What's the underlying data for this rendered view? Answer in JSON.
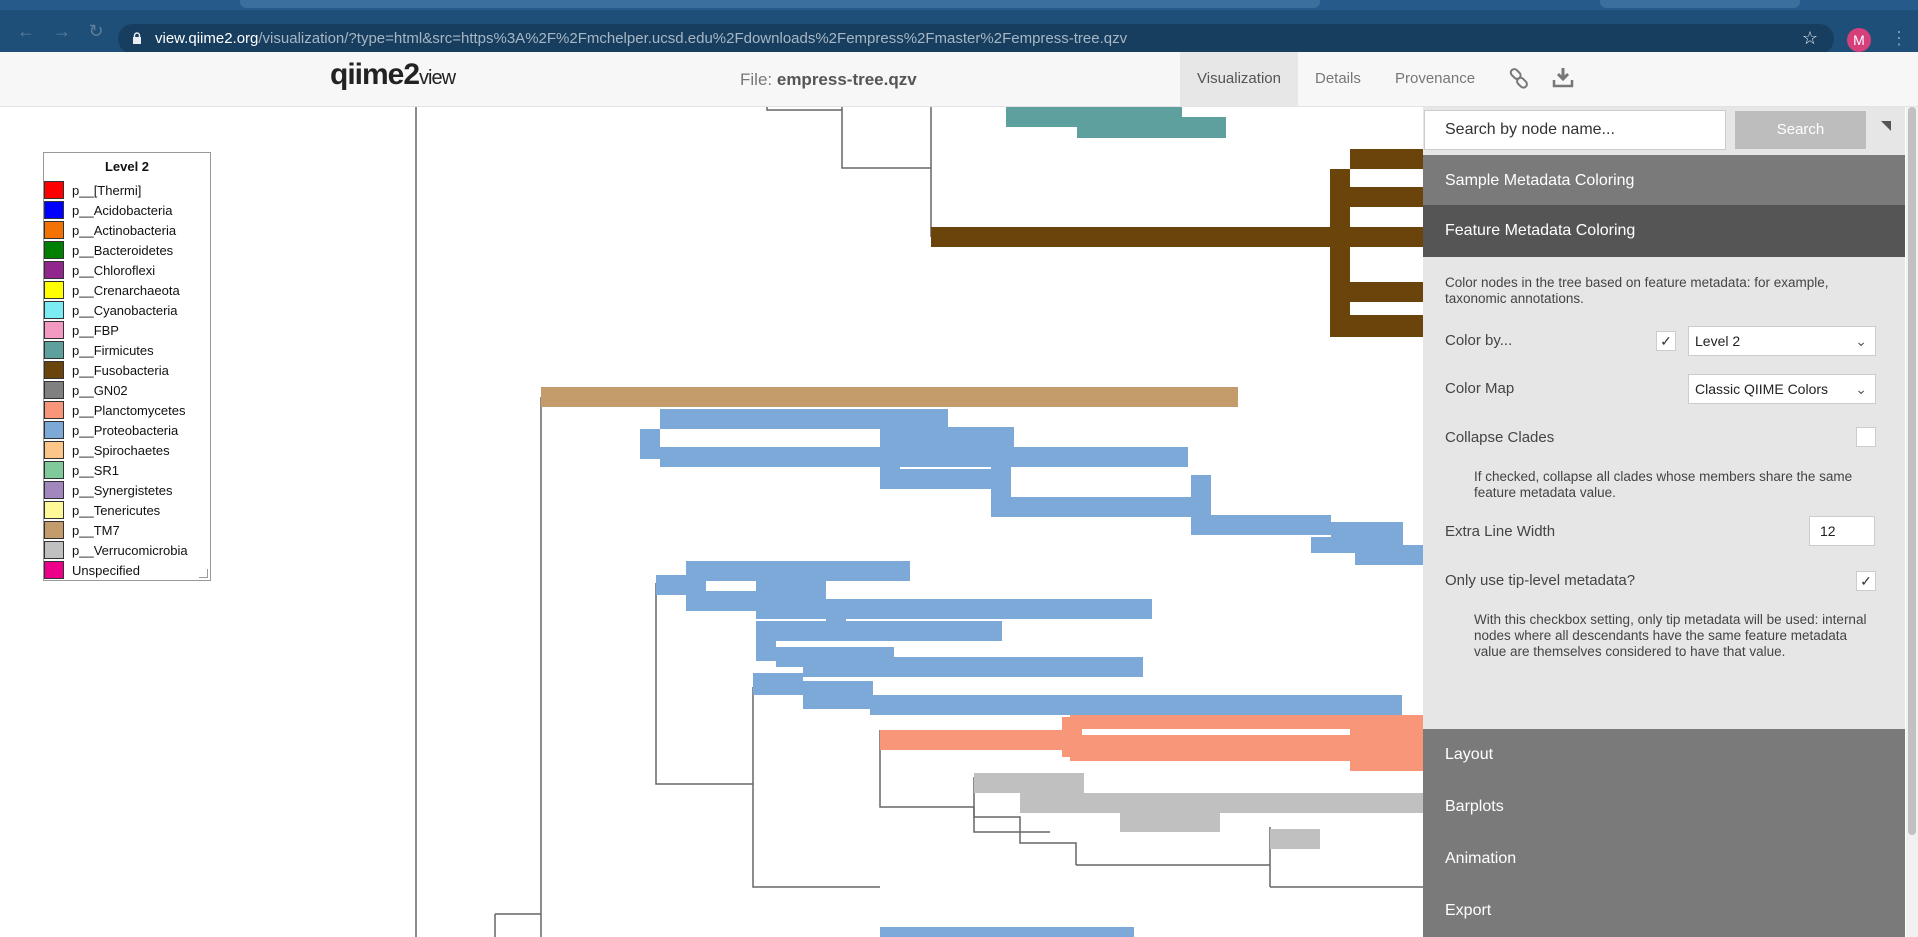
{
  "browser": {
    "url_host": "view.qiime2.org",
    "url_path": "/visualization/?type=html&src=https%3A%2F%2Fmchelper.ucsd.edu%2Fdownloads%2Fempress%2Fmaster%2Fempress-tree.qzv",
    "avatar_initial": "M"
  },
  "header": {
    "logo_text": "qiime2",
    "logo_view": "view",
    "file_label": "File:",
    "file_name": "empress-tree.qzv",
    "tabs": {
      "visualization": "Visualization",
      "details": "Details",
      "provenance": "Provenance"
    }
  },
  "legend": {
    "title": "Level 2",
    "items": [
      {
        "label": "p__[Thermi]",
        "color": "#ff0000"
      },
      {
        "label": "p__Acidobacteria",
        "color": "#0000ff"
      },
      {
        "label": "p__Actinobacteria",
        "color": "#f27304"
      },
      {
        "label": "p__Bacteroidetes",
        "color": "#008000"
      },
      {
        "label": "p__Chloroflexi",
        "color": "#91278d"
      },
      {
        "label": "p__Crenarchaeota",
        "color": "#ffff00"
      },
      {
        "label": "p__Cyanobacteria",
        "color": "#7cecf4"
      },
      {
        "label": "p__FBP",
        "color": "#f49ac2"
      },
      {
        "label": "p__Firmicutes",
        "color": "#5da09e"
      },
      {
        "label": "p__Fusobacteria",
        "color": "#6b440b"
      },
      {
        "label": "p__GN02",
        "color": "#808080"
      },
      {
        "label": "p__Planctomycetes",
        "color": "#f79679"
      },
      {
        "label": "p__Proteobacteria",
        "color": "#7da9d8"
      },
      {
        "label": "p__Spirochaetes",
        "color": "#fcc688"
      },
      {
        "label": "p__SR1",
        "color": "#80c99b"
      },
      {
        "label": "p__Synergistetes",
        "color": "#a287bf"
      },
      {
        "label": "p__Tenericutes",
        "color": "#fff899"
      },
      {
        "label": "p__TM7",
        "color": "#c49c6b"
      },
      {
        "label": "p__Verrucomicrobia",
        "color": "#c0c0c0"
      },
      {
        "label": "Unspecified",
        "color": "#ed008a"
      }
    ]
  },
  "panel": {
    "search_placeholder": "Search by node name...",
    "search_button": "Search",
    "sections": {
      "sample_metadata": "Sample Metadata Coloring",
      "feature_metadata": "Feature Metadata Coloring",
      "layout": "Layout",
      "barplots": "Barplots",
      "animation": "Animation",
      "export": "Export"
    },
    "feature": {
      "description": "Color nodes in the tree based on feature metadata: for example, taxonomic annotations.",
      "color_by_label": "Color by...",
      "color_by_value": "Level 2",
      "color_map_label": "Color Map",
      "color_map_value": "Classic QIIME Colors",
      "collapse_label": "Collapse Clades",
      "collapse_help": "If checked, collapse all clades whose members share the same feature metadata value.",
      "line_width_label": "Extra Line Width",
      "line_width_value": "12",
      "tip_label": "Only use tip-level metadata?",
      "tip_help": "With this checkbox setting, only tip metadata will be used: internal nodes where all descendants have the same feature metadata value are themselves considered to have that value."
    }
  },
  "colors": {
    "proteobacteria": "#7da9d8",
    "fusobacteria": "#6b440b",
    "firmicutes": "#5da09e",
    "tm7": "#c49c6b",
    "planctomycetes": "#f79679",
    "verrucomicrobia": "#c0c0c0",
    "tree_line": "#666666"
  }
}
